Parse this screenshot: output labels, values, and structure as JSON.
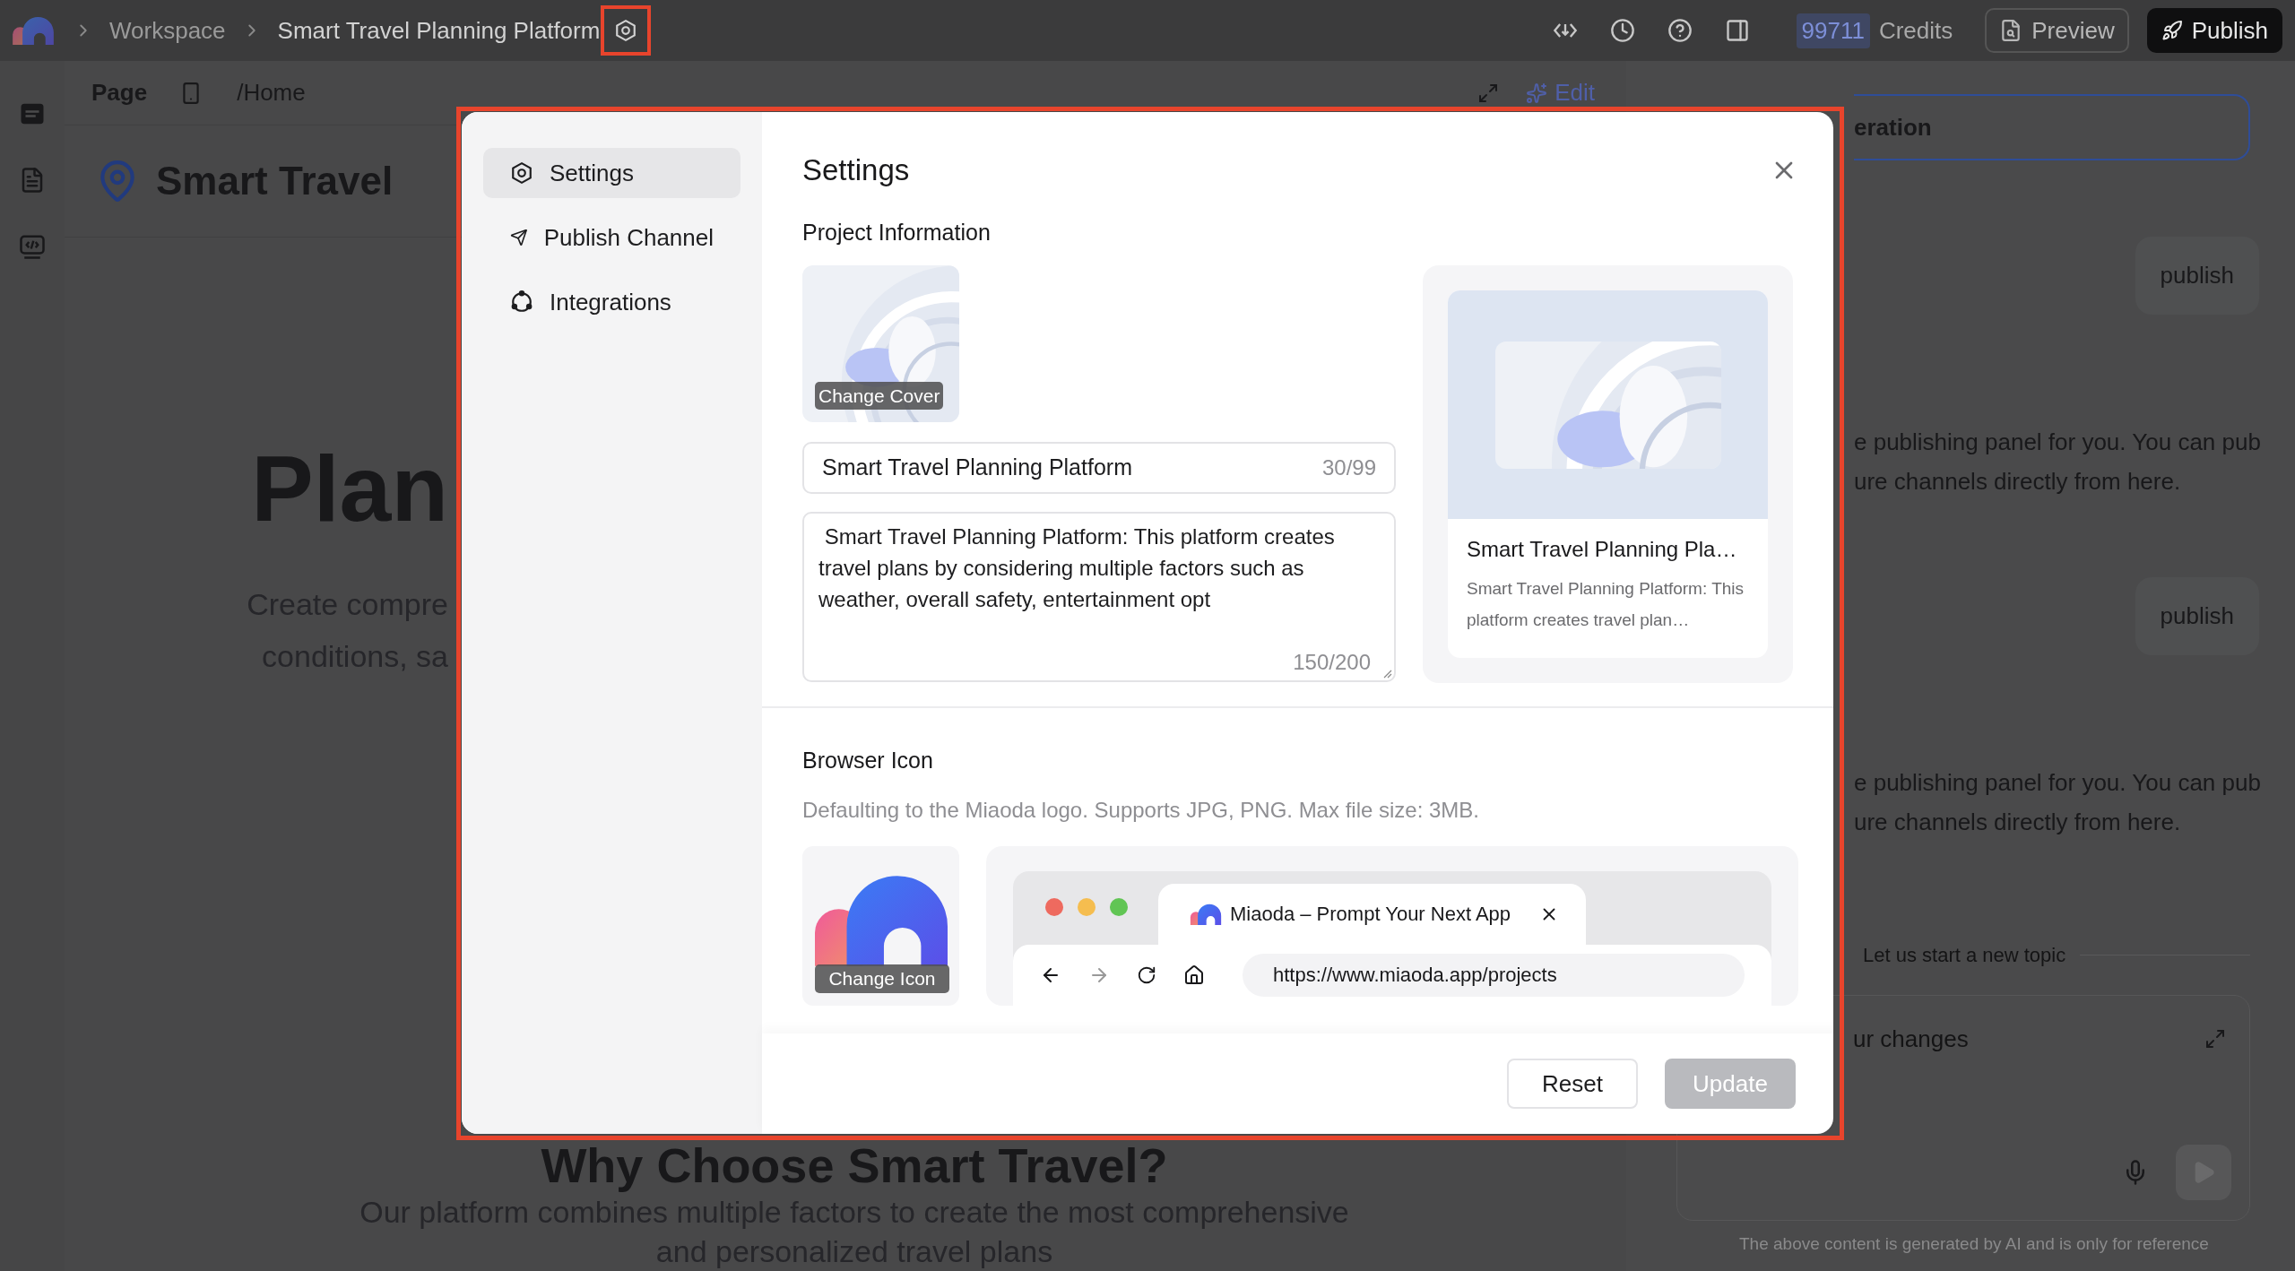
{
  "top_bar": {
    "breadcrumbs": [
      "Workspace",
      "Smart Travel Planning Platform"
    ],
    "credits_value": "99711",
    "credits_label": "Credits",
    "preview_button": "Preview",
    "publish_button": "Publish"
  },
  "canvas": {
    "page_label": "Page",
    "route": "/Home",
    "edit_button": "Edit",
    "brand": "Smart Travel",
    "hero_title": "Plan",
    "hero_lines": [
      "Create compre",
      "conditions, sa"
    ],
    "section_title": "Why Choose Smart Travel?",
    "section_lines": [
      "Our platform combines multiple factors to create the most comprehensive",
      "and personalized travel plans"
    ]
  },
  "assistant": {
    "banner": "eration",
    "messages": [
      {
        "kind": "user",
        "text": "publish"
      },
      {
        "kind": "assistant",
        "lines": [
          "e publishing panel for you. You can pub",
          "ure channels directly from here."
        ]
      },
      {
        "kind": "user",
        "text": "publish"
      },
      {
        "kind": "assistant",
        "lines": [
          "e publishing panel for you. You can pub",
          "ure channels directly from here."
        ]
      }
    ],
    "divider": "Let us start a new topic",
    "placeholder": "ur changes",
    "footnote": "The above content is generated by AI and is only for reference"
  },
  "dialog": {
    "nav": [
      {
        "label": "Settings",
        "selected": true
      },
      {
        "label": "Publish Channel",
        "selected": false
      },
      {
        "label": "Integrations",
        "selected": false
      }
    ],
    "title": "Settings",
    "project_section": "Project Information",
    "cover_button": "Change Cover",
    "name_field": {
      "value": "Smart Travel Planning Platform",
      "counter": "30/99"
    },
    "description_field": {
      "value": " Smart Travel Planning Platform: This platform creates travel plans by considering multiple factors such as weather, overall safety, entertainment opt",
      "counter": "150/200"
    },
    "preview_card": {
      "title": "Smart Travel Planning Pla…",
      "description": "Smart Travel Planning Platform: This platform creates travel plan…"
    },
    "browser_section": "Browser Icon",
    "browser_hint": "Defaulting to the Miaoda logo. Supports JPG, PNG. Max file size: 3MB.",
    "icon_button": "Change Icon",
    "browser_tab": "Miaoda – Prompt Your Next App",
    "url": "https://www.miaoda.app/projects",
    "reset_button": "Reset",
    "update_button": {
      "label": "Update",
      "disabled": true
    }
  }
}
